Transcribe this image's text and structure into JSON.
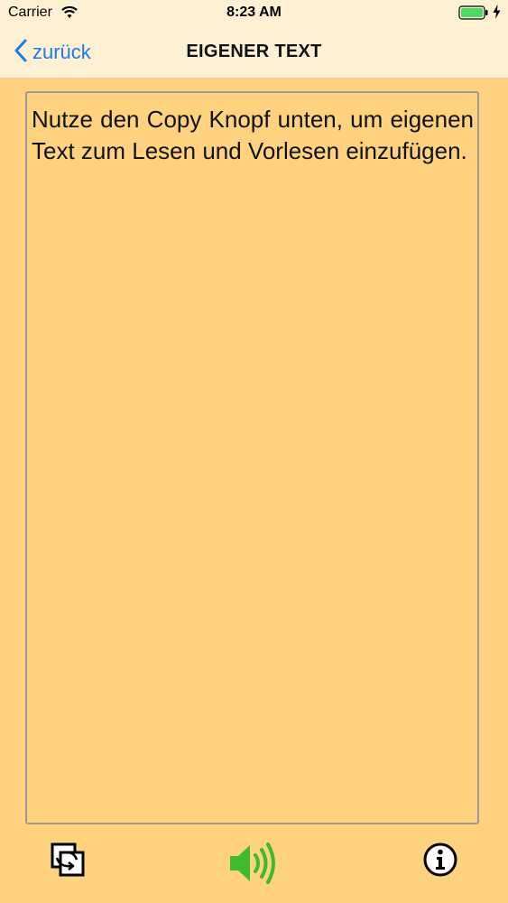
{
  "status_bar": {
    "carrier": "Carrier",
    "time": "8:23 AM"
  },
  "nav": {
    "back_label": "zurück",
    "title": "EIGENER TEXT"
  },
  "content": {
    "text": "Nutze den Copy Knopf unten, um eigenen Text zum Lesen und Vorlesen einzufügen."
  },
  "toolbar": {
    "icons": [
      "copy-paste-icon",
      "speaker-icon",
      "info-icon"
    ]
  },
  "colors": {
    "background": "#FFD27F",
    "bar_background": "#FDF0D3",
    "accent_blue": "#1A7BF2",
    "speaker_green": "#3DBA2E",
    "battery_green": "#4CD964"
  }
}
